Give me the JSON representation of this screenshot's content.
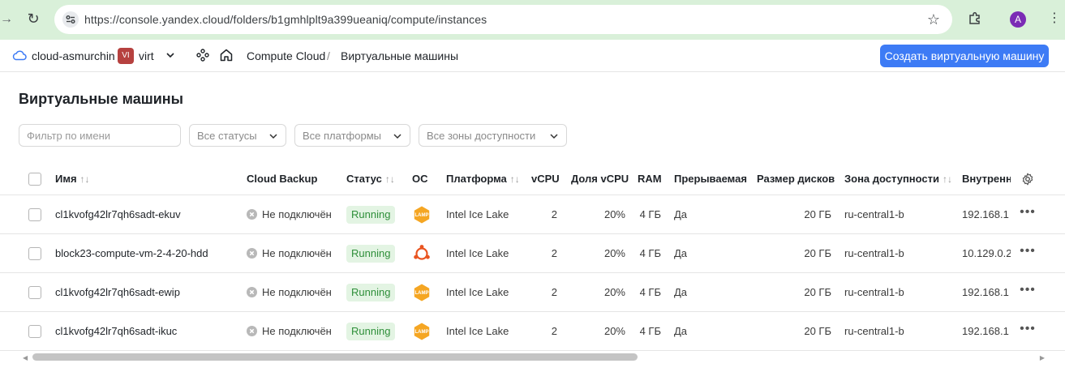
{
  "browser": {
    "url": "https://console.yandex.cloud/folders/b1gmhlplt9a399ueaniq/compute/instances",
    "profile_initial": "A"
  },
  "header": {
    "cloud_name": "cloud-asmurchin",
    "folder_badge": "VI",
    "folder_name": "virt",
    "breadcrumb": [
      "Compute Cloud",
      "/",
      "Виртуальные машины"
    ],
    "create_button": "Создать виртуальную машину"
  },
  "page": {
    "title": "Виртуальные машины",
    "filter_placeholder": "Фильтр по имени",
    "filters": [
      "Все статусы",
      "Все платформы",
      "Все зоны доступности"
    ]
  },
  "table": {
    "columns": [
      "Имя",
      "Cloud Backup",
      "Статус",
      "ОС",
      "Платформа",
      "vCPU",
      "Доля vCPU",
      "RAM",
      "Прерываемая",
      "Размер дисков",
      "Зона доступности",
      "Внутренн"
    ],
    "sort_glyph": "↑↓",
    "rows": [
      {
        "name": "cl1kvofg42lr7qh6sadt-ekuv",
        "backup": "Не подключён",
        "status": "Running",
        "os": "lamp",
        "platform": "Intel Ice Lake",
        "vcpu": "2",
        "vcpu_share": "20%",
        "ram": "4 ГБ",
        "preemptible": "Да",
        "disk": "20 ГБ",
        "zone": "ru-central1-b",
        "internal_ip": "192.168.1"
      },
      {
        "name": "block23-compute-vm-2-4-20-hdd",
        "backup": "Не подключён",
        "status": "Running",
        "os": "ubuntu",
        "platform": "Intel Ice Lake",
        "vcpu": "2",
        "vcpu_share": "20%",
        "ram": "4 ГБ",
        "preemptible": "Да",
        "disk": "20 ГБ",
        "zone": "ru-central1-b",
        "internal_ip": "10.129.0.2"
      },
      {
        "name": "cl1kvofg42lr7qh6sadt-ewip",
        "backup": "Не подключён",
        "status": "Running",
        "os": "lamp",
        "platform": "Intel Ice Lake",
        "vcpu": "2",
        "vcpu_share": "20%",
        "ram": "4 ГБ",
        "preemptible": "Да",
        "disk": "20 ГБ",
        "zone": "ru-central1-b",
        "internal_ip": "192.168.1"
      },
      {
        "name": "cl1kvofg42lr7qh6sadt-ikuc",
        "backup": "Не подключён",
        "status": "Running",
        "os": "lamp",
        "platform": "Intel Ice Lake",
        "vcpu": "2",
        "vcpu_share": "20%",
        "ram": "4 ГБ",
        "preemptible": "Да",
        "disk": "20 ГБ",
        "zone": "ru-central1-b",
        "internal_ip": "192.168.1"
      }
    ]
  },
  "colors": {
    "accent": "#3d7bf5",
    "status_running_bg": "#e3f4e3",
    "status_running_fg": "#2f8f3a",
    "lamp_icon": "#f5a623",
    "ubuntu_icon": "#e95420"
  }
}
